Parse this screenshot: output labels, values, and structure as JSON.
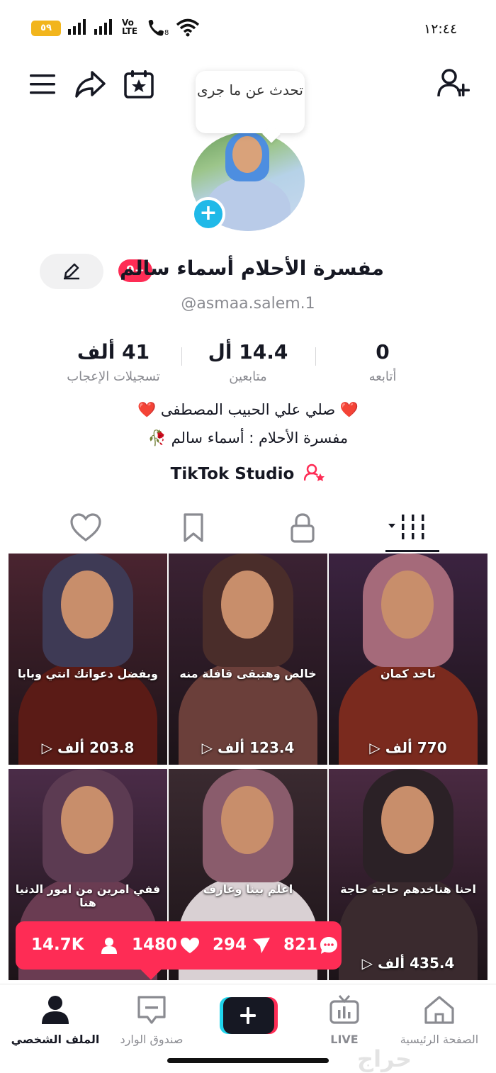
{
  "status_bar": {
    "battery": "٥٩",
    "network_label": "Vo\nLTE",
    "clock": "١٢:٤٤"
  },
  "header": {
    "prompt_bubble": "تحدث عن ما جرى"
  },
  "profile": {
    "badge": "9+",
    "name": "مفسرة الأحلام أسماء سالم",
    "handle": "@asmaa.salem.1",
    "stats": [
      {
        "value": "0",
        "label": "أتابعه"
      },
      {
        "value": "14.4 أل",
        "label": "متابعين"
      },
      {
        "value": "41 ألف",
        "label": "تسجيلات الإعجاب"
      }
    ],
    "bio_lines": [
      "❤️ صلي علي الحبيب المصطفى ❤️",
      "مفسرة الأحلام : أسماء سالم 🥀"
    ],
    "studio_label": "TikTok Studio"
  },
  "videos": [
    {
      "caption": "وبفضل دعواتك انتي وبابا",
      "views": "203.8 ألف",
      "scarf": "#3e3a55",
      "bg": "#4a2430",
      "cloth": "#5a1b16"
    },
    {
      "caption": "خالص وهتبقى قافلة منه",
      "views": "123.4 ألف",
      "scarf": "#4a2d2a",
      "bg": "#3b2233",
      "cloth": "#6b3f3a"
    },
    {
      "caption": "ناخد كمان",
      "views": "770 ألف",
      "scarf": "#a56a7a",
      "bg": "#3b2340",
      "cloth": "#7a2a1e"
    },
    {
      "caption": "ففي امرين من امور الدنيا هنا",
      "views": "",
      "scarf": "#5c3b52",
      "bg": "#4b2c48",
      "cloth": "#6a3c52"
    },
    {
      "caption": "اعلم بينا وعارف",
      "views": "",
      "scarf": "#8a5c6c",
      "bg": "#3a2a30",
      "cloth": "#d9d0d3"
    },
    {
      "caption": "احنا هناخدهم حاجة حاجة",
      "views": "435.4 ألف",
      "scarf": "#2b2126",
      "bg": "#4a2a42",
      "cloth": "#3a2a2e"
    }
  ],
  "popup": {
    "followers": "14.7K",
    "likes": "1480",
    "shares": "294",
    "comments": "821"
  },
  "nav": {
    "home": "الصفحة الرئيسية",
    "live": "LIVE",
    "inbox": "صندوق الوارد",
    "profile": "الملف الشخصي",
    "watermark": "حراج"
  },
  "colors": {
    "accent": "#fe2c55",
    "cyan": "#20b9e8",
    "battery": "#f2b51c"
  }
}
